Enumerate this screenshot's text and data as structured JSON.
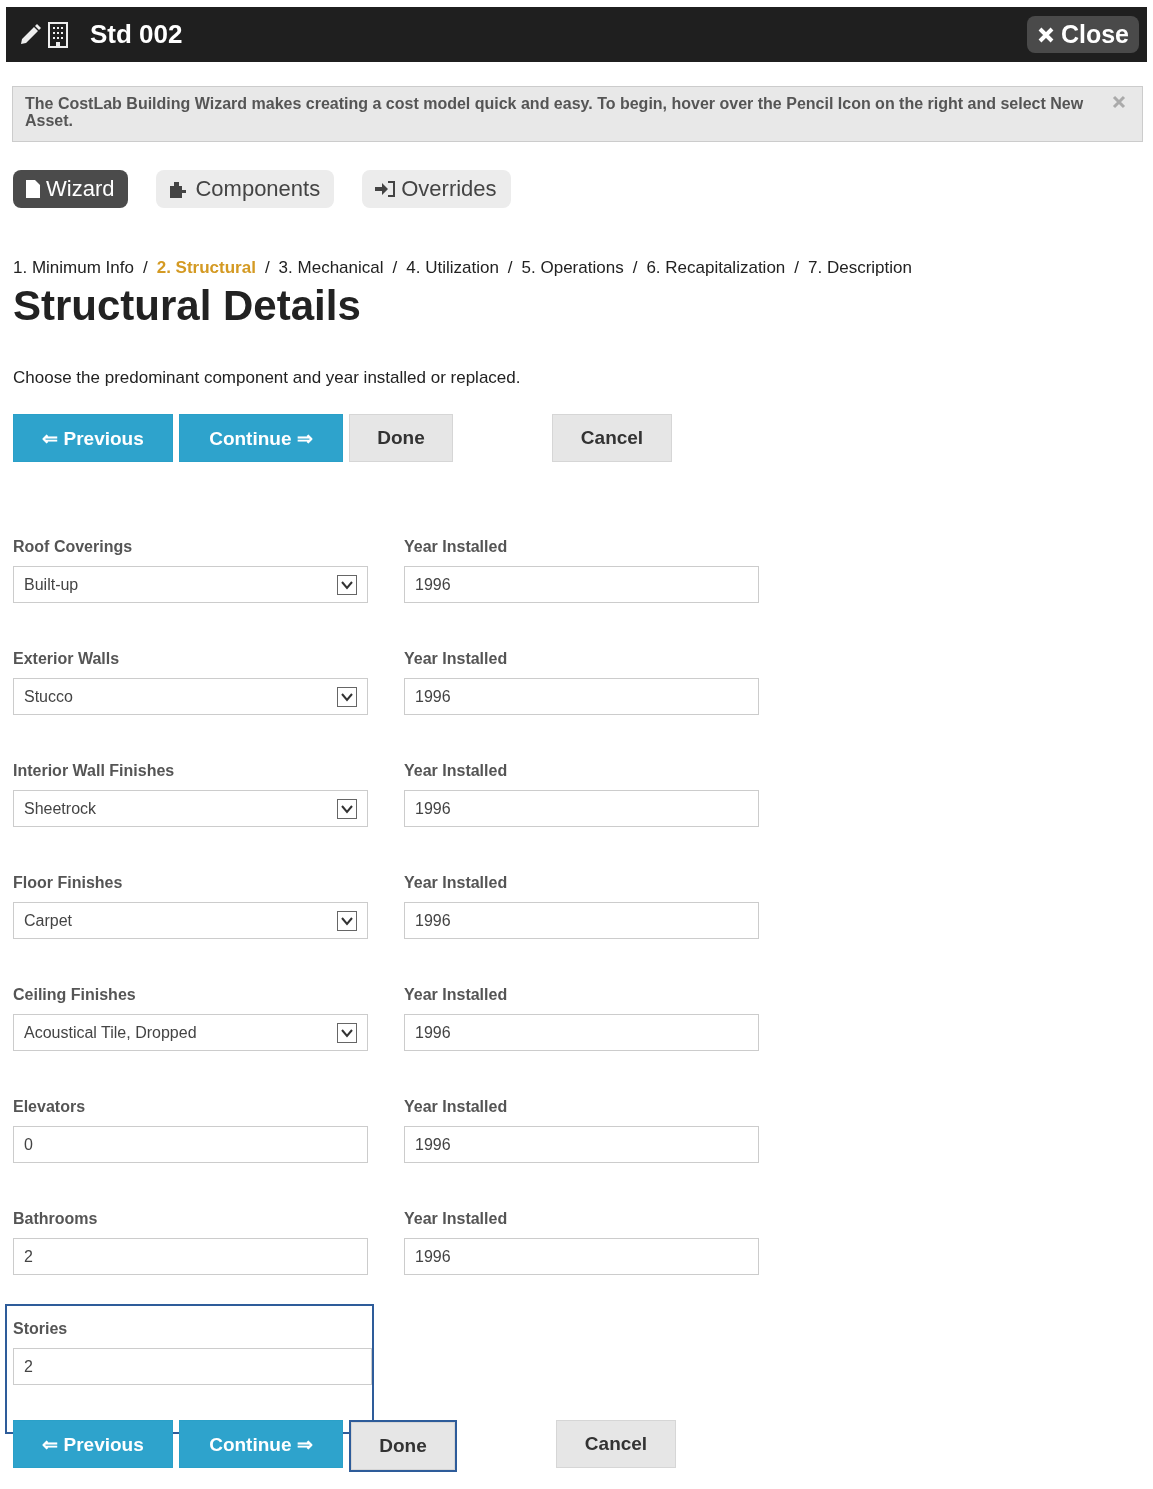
{
  "header": {
    "title": "Std 002",
    "close": "Close"
  },
  "notice": {
    "text": "The CostLab Building Wizard makes creating a cost model quick and easy. To begin, hover over the Pencil Icon on the right and select New Asset."
  },
  "tabs": [
    {
      "label": "Wizard",
      "kind": "doc",
      "selected": true
    },
    {
      "label": "Components",
      "kind": "puzzle",
      "selected": false
    },
    {
      "label": "Overrides",
      "kind": "signin",
      "selected": false
    }
  ],
  "steps": [
    {
      "label": "1. Minimum Info",
      "selected": false
    },
    {
      "separator": "/",
      "label": "2. Structural",
      "selected": true
    },
    {
      "separator": "/",
      "label": "3. Mechanical",
      "selected": false
    },
    {
      "separator": "/",
      "label": "4. Utilization",
      "selected": false
    },
    {
      "separator": "/",
      "label": "5. Operations",
      "selected": false
    },
    {
      "separator": "/",
      "label": "6. Recapitalization",
      "selected": false
    },
    {
      "separator": "/",
      "label": "7. Description",
      "selected": false
    }
  ],
  "title": "Structural Details",
  "intro": "Choose the predominant component and year installed or replaced.",
  "top_buttons": [
    {
      "label": "⇐ Previous",
      "kind": "primary",
      "highlighted": false
    },
    {
      "label": "Continue ⇒",
      "kind": "primary",
      "highlighted": false
    },
    {
      "label": "Done",
      "kind": "default",
      "highlighted": false
    },
    {
      "label": "Cancel",
      "kind": "cancel",
      "highlighted": false
    }
  ],
  "fields": [
    {
      "label": "Roof Coverings",
      "kind": "select",
      "value": "Built-up",
      "year_label": "Year Installed",
      "year": "1996",
      "highlighted": false
    },
    {
      "label": "Exterior Walls",
      "kind": "select",
      "value": "Stucco",
      "year_label": "Year Installed",
      "year": "1996",
      "highlighted": false
    },
    {
      "label": "Interior Wall Finishes",
      "kind": "select",
      "value": "Sheetrock",
      "year_label": "Year Installed",
      "year": "1996",
      "highlighted": false
    },
    {
      "label": "Floor Finishes",
      "kind": "select",
      "value": "Carpet",
      "year_label": "Year Installed",
      "year": "1996",
      "highlighted": false
    },
    {
      "label": "Ceiling Finishes",
      "kind": "select",
      "value": "Acoustical Tile, Dropped",
      "year_label": "Year Installed",
      "year": "1996",
      "highlighted": false
    },
    {
      "label": "Elevators",
      "kind": "text",
      "value": "0",
      "year_label": "Year Installed",
      "year": "1996",
      "highlighted": false
    },
    {
      "label": "Bathrooms",
      "kind": "text",
      "value": "2",
      "year_label": "Year Installed",
      "year": "1996",
      "highlighted": false
    },
    {
      "label": "Stories",
      "kind": "text",
      "value": "2",
      "highlighted": true
    }
  ],
  "bottom_buttons": [
    {
      "label": "⇐ Previous",
      "kind": "primary",
      "highlighted": false
    },
    {
      "label": "Continue ⇒",
      "kind": "primary",
      "highlighted": false
    },
    {
      "label": "Done",
      "kind": "default",
      "highlighted": true
    },
    {
      "label": "Cancel",
      "kind": "cancel",
      "highlighted": false
    }
  ]
}
